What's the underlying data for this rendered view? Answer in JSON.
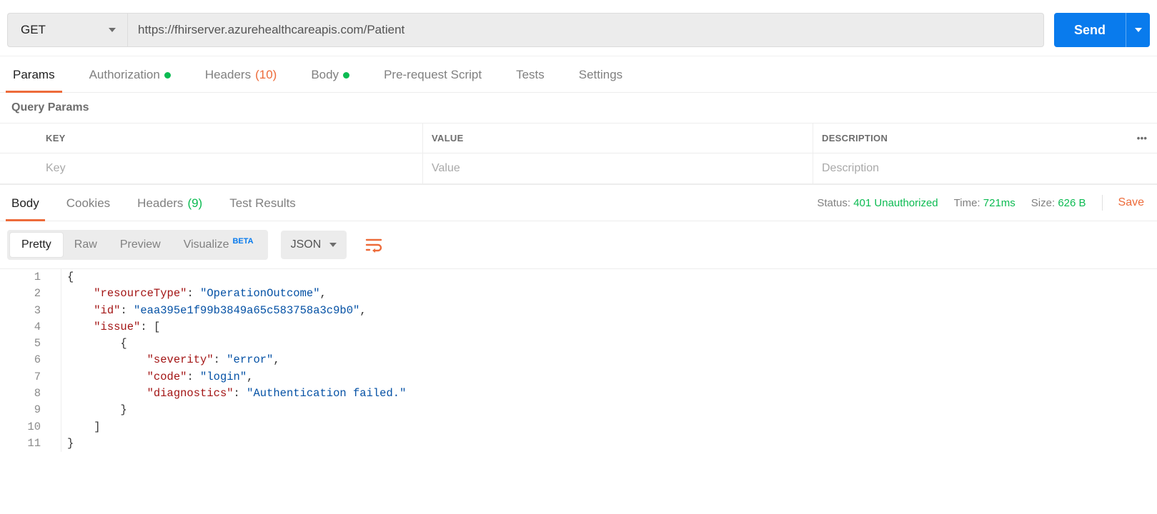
{
  "request": {
    "method": "GET",
    "url": "https://fhirserver.azurehealthcareapis.com/Patient",
    "send_label": "Send"
  },
  "reqTabs": {
    "params": "Params",
    "authorization": "Authorization",
    "headers": "Headers",
    "headers_count": "(10)",
    "body": "Body",
    "prerequest": "Pre-request Script",
    "tests": "Tests",
    "settings": "Settings"
  },
  "queryParams": {
    "title": "Query Params",
    "headers": {
      "key": "KEY",
      "value": "VALUE",
      "description": "DESCRIPTION"
    },
    "placeholders": {
      "key": "Key",
      "value": "Value",
      "description": "Description"
    }
  },
  "respTabs": {
    "body": "Body",
    "cookies": "Cookies",
    "headers": "Headers",
    "headers_count": "(9)",
    "testresults": "Test Results"
  },
  "respMeta": {
    "status_label": "Status:",
    "status_value": "401 Unauthorized",
    "time_label": "Time:",
    "time_value": "721ms",
    "size_label": "Size:",
    "size_value": "626 B",
    "save": "Save"
  },
  "viewBar": {
    "pretty": "Pretty",
    "raw": "Raw",
    "preview": "Preview",
    "visualize": "Visualize",
    "visualize_badge": "BETA",
    "format": "JSON"
  },
  "responseBody": {
    "lines": [
      {
        "n": 1,
        "indent": 0,
        "tokens": [
          {
            "t": "punc",
            "v": "{"
          }
        ]
      },
      {
        "n": 2,
        "indent": 1,
        "tokens": [
          {
            "t": "key",
            "v": "\"resourceType\""
          },
          {
            "t": "punc",
            "v": ": "
          },
          {
            "t": "str",
            "v": "\"OperationOutcome\""
          },
          {
            "t": "punc",
            "v": ","
          }
        ]
      },
      {
        "n": 3,
        "indent": 1,
        "tokens": [
          {
            "t": "key",
            "v": "\"id\""
          },
          {
            "t": "punc",
            "v": ": "
          },
          {
            "t": "str",
            "v": "\"eaa395e1f99b3849a65c583758a3c9b0\""
          },
          {
            "t": "punc",
            "v": ","
          }
        ]
      },
      {
        "n": 4,
        "indent": 1,
        "tokens": [
          {
            "t": "key",
            "v": "\"issue\""
          },
          {
            "t": "punc",
            "v": ": ["
          }
        ]
      },
      {
        "n": 5,
        "indent": 2,
        "tokens": [
          {
            "t": "punc",
            "v": "{"
          }
        ]
      },
      {
        "n": 6,
        "indent": 3,
        "tokens": [
          {
            "t": "key",
            "v": "\"severity\""
          },
          {
            "t": "punc",
            "v": ": "
          },
          {
            "t": "str",
            "v": "\"error\""
          },
          {
            "t": "punc",
            "v": ","
          }
        ]
      },
      {
        "n": 7,
        "indent": 3,
        "tokens": [
          {
            "t": "key",
            "v": "\"code\""
          },
          {
            "t": "punc",
            "v": ": "
          },
          {
            "t": "str",
            "v": "\"login\""
          },
          {
            "t": "punc",
            "v": ","
          }
        ]
      },
      {
        "n": 8,
        "indent": 3,
        "tokens": [
          {
            "t": "key",
            "v": "\"diagnostics\""
          },
          {
            "t": "punc",
            "v": ": "
          },
          {
            "t": "str",
            "v": "\"Authentication failed.\""
          }
        ]
      },
      {
        "n": 9,
        "indent": 2,
        "tokens": [
          {
            "t": "punc",
            "v": "}"
          }
        ]
      },
      {
        "n": 10,
        "indent": 1,
        "tokens": [
          {
            "t": "punc",
            "v": "]"
          }
        ]
      },
      {
        "n": 11,
        "indent": 0,
        "tokens": [
          {
            "t": "punc",
            "v": "}"
          }
        ]
      }
    ]
  }
}
